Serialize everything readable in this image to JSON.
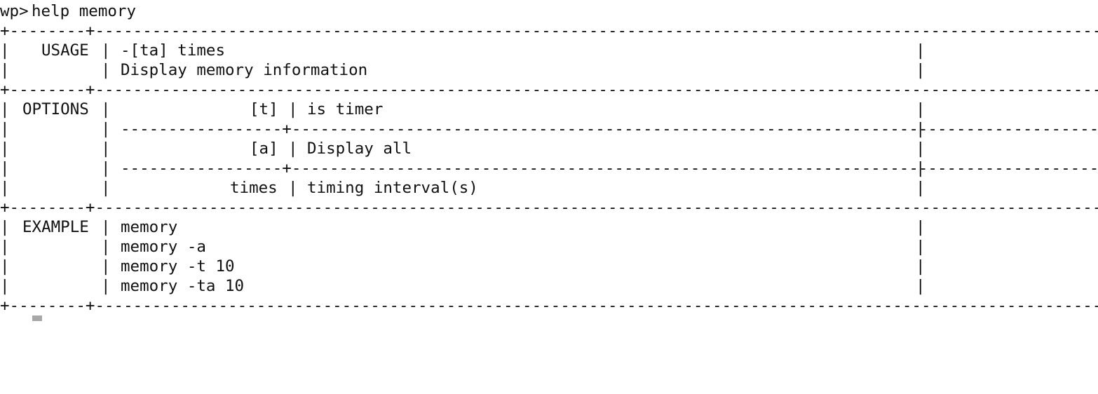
{
  "terminal": {
    "prompt": "wp>",
    "command": "help memory",
    "table": {
      "usage": {
        "label": "USAGE",
        "lines": [
          "-[ta] times",
          "Display memory information"
        ]
      },
      "options": {
        "label": "OPTIONS",
        "rows": [
          {
            "flag": "[t]",
            "desc": "is timer"
          },
          {
            "flag": "[a]",
            "desc": "Display all"
          },
          {
            "flag": "times",
            "desc": "timing interval(s)"
          }
        ]
      },
      "example": {
        "label": "EXAMPLE",
        "lines": [
          "memory",
          "memory -a",
          "memory -t 10",
          "memory -ta 10"
        ]
      }
    }
  }
}
